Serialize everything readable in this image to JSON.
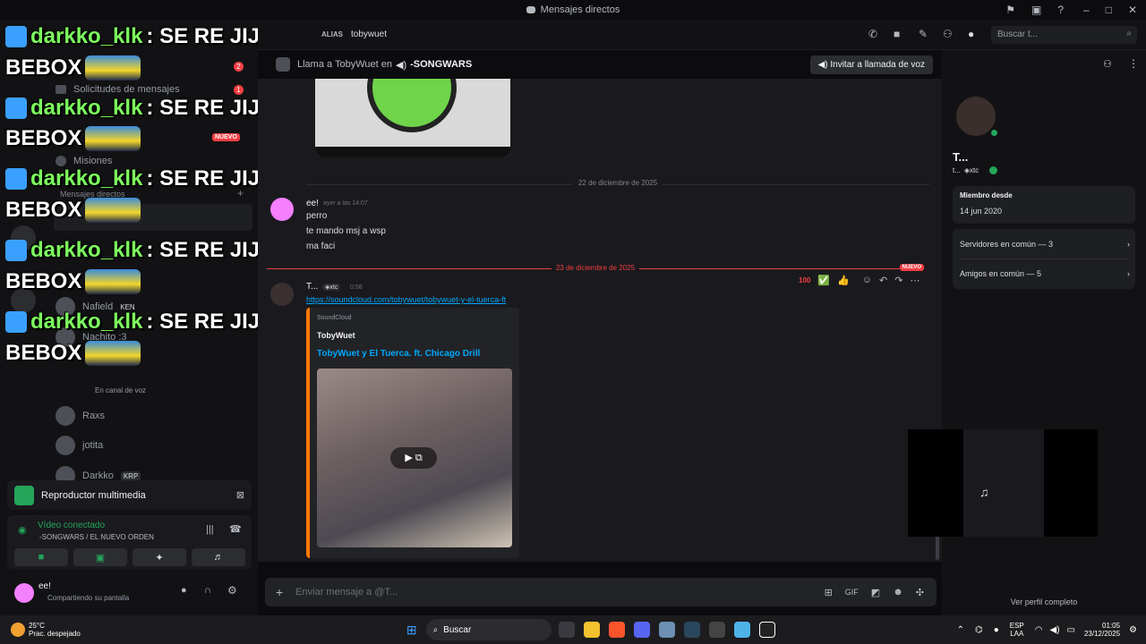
{
  "window": {
    "title": "Mensajes directos"
  },
  "header": {
    "alias_label": "ALIAS",
    "alias_value": "tobywuet",
    "search_placeholder": "Buscar t..."
  },
  "callbar": {
    "prefix": "Llama a TobyWuet en",
    "channel": "-SONGWARS",
    "invite_label": "Invitar a llamada de voz"
  },
  "overlay": {
    "name": "darkko_klk",
    "message": " : SE RE JIJEA EL",
    "line2": "BEBOX"
  },
  "sidebar": {
    "message_requests": "Solicitudes de mensajes",
    "message_requests_badge": "1",
    "badge_2": "2",
    "new_badge": "NUEVO",
    "missions": "Misiones",
    "dm_header": "Mensajes directos",
    "dms": [
      {
        "name": "Nafield",
        "tag": "KEN"
      },
      {
        "name": "Nachito :3",
        "tag": ""
      },
      {
        "name": "Raxs",
        "tag": ""
      },
      {
        "name": "jotita",
        "tag": ""
      },
      {
        "name": "Darkko",
        "tag": "KRP"
      }
    ],
    "voice_sub": "En canal de voz"
  },
  "media_player": {
    "label": "Reproductor multimedia"
  },
  "voice": {
    "status": "Vídeo conectado",
    "channel": "-SONGWARS / EL NUEVO ORDEN"
  },
  "user": {
    "name": "ee!",
    "status": "Compartiendo su pantalla"
  },
  "chat": {
    "date1": "22 de diciembre de 2025",
    "date2": "23 de diciembre de 2025",
    "new_label": "NUEVO",
    "msg1": {
      "author": "ee!",
      "time": "ayer a las 14:07",
      "lines": [
        "perro",
        "te mando msj a wsp",
        "ma faci"
      ]
    },
    "msg2": {
      "author": "T...",
      "tag": "xtc",
      "time": "0:58",
      "link": "https://soundcloud.com/tobywuet/tobywuet-y-el-tuerca-ft"
    },
    "embed": {
      "provider": "SoundCloud",
      "author": "TobyWuet",
      "title": "TobyWuet y El Tuerca. ft. Chicago Drill"
    },
    "reactions": [
      "100",
      "✅",
      "👍"
    ]
  },
  "composer": {
    "placeholder": "Enviar mensaje a @T..."
  },
  "profile": {
    "name": "T...",
    "handle": "t...",
    "tag": "xtc",
    "member_since_label": "Miembro desde",
    "member_since": "14 jun 2020",
    "servers": "Servidores en común — 3",
    "friends": "Amigos en común — 5",
    "view_full": "Ver perfil completo"
  },
  "taskbar": {
    "temp": "25°C",
    "weather": "Prac. despejado",
    "search": "Buscar",
    "lang1": "ESP",
    "lang2": "LAA",
    "time": "01:05",
    "date": "23/12/2025"
  },
  "colors": {
    "accent": "#5865f2",
    "green": "#23a55a",
    "red": "#f23f43",
    "link": "#00a8fc"
  }
}
